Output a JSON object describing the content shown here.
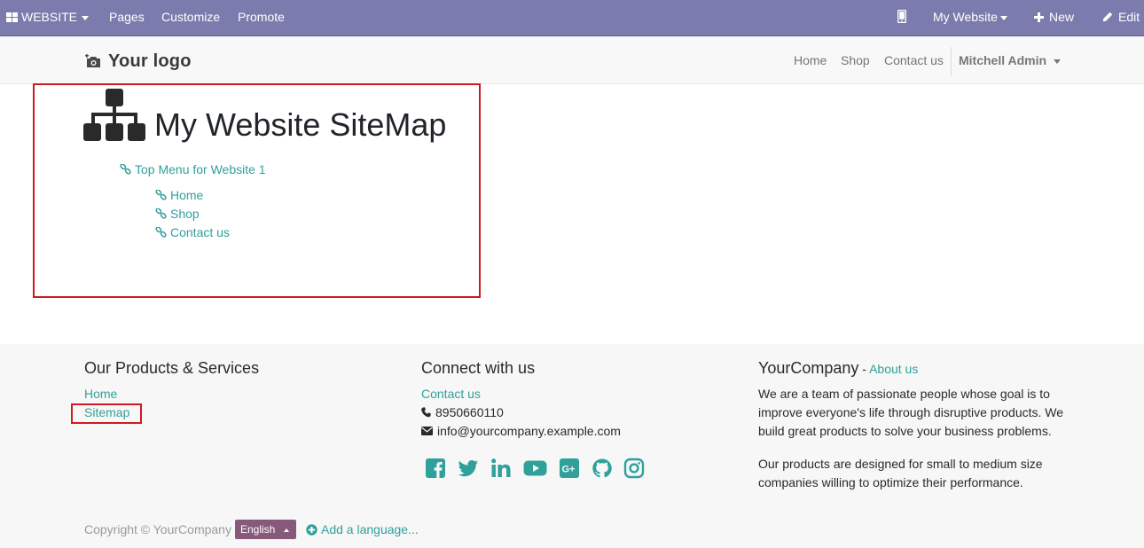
{
  "admin_bar": {
    "app_menu_label": "WEBSITE",
    "pages_label": "Pages",
    "customize_label": "Customize",
    "promote_label": "Promote",
    "website_selector_label": "My Website",
    "new_label": "New",
    "edit_label": "Edit",
    "background_color": "#7c7bad"
  },
  "header": {
    "logo_text": "Your logo",
    "nav": [
      "Home",
      "Shop",
      "Contact us"
    ],
    "user_name": "Mitchell Admin"
  },
  "sitemap": {
    "title": "My Website SiteMap",
    "root_link": "Top Menu for Website 1",
    "children": [
      "Home",
      "Shop",
      "Contact us"
    ],
    "highlight_color": "#cc1b22"
  },
  "footer": {
    "products_heading": "Our Products & Services",
    "products_links": [
      "Home",
      "Sitemap"
    ],
    "connect_heading": "Connect with us",
    "contact_link": "Contact us",
    "phone": "8950660110",
    "email": "info@yourcompany.example.com",
    "social_icons": [
      "facebook-icon",
      "twitter-icon",
      "linkedin-icon",
      "youtube-icon",
      "google-plus-icon",
      "github-icon",
      "instagram-icon"
    ],
    "company_name": "YourCompany",
    "company_separator": " - ",
    "about_link": "About us",
    "about_text_1": "We are a team of passionate people whose goal is to improve everyone's life through disruptive products. We build great products to solve your business problems.",
    "about_text_2": "Our products are designed for small to medium size companies willing to optimize their performance.",
    "copyright": "Copyright © YourCompany",
    "language": "English",
    "add_language": "Add a language...",
    "accent_color": "#30a09b",
    "language_button_color": "#875a7b"
  }
}
